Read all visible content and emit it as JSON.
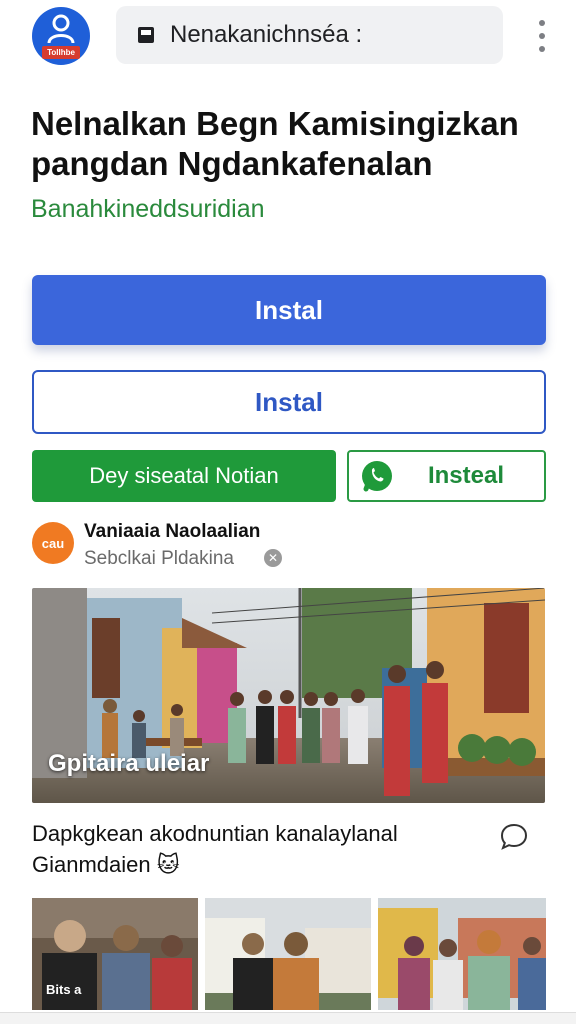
{
  "header": {
    "avatar_badge": "Tollhbe",
    "url": "Nenakanichnséa :",
    "menu_icon": "more-vert-icon"
  },
  "article": {
    "title": "Nelnalkan Begn Kamisingizkan pangdan Ngdankafenalan",
    "subtitle": "Banahkineddsuridian"
  },
  "buttons": {
    "primary_install": "Instal",
    "secondary_install": "Instal",
    "green_action": "Dey siseatal Notian",
    "whatsapp_action": "Insteal"
  },
  "source": {
    "logo_text": "cau",
    "name": "Vaniaaia Naolaalian",
    "subtitle": "Sebclkai Pldakina"
  },
  "hero": {
    "caption": "Gpitaira uleiar"
  },
  "story": {
    "title": "Dapkgkean akodnuntian kanalaylanal Gianmdaien 🐱"
  },
  "thumbnails": {
    "first_caption": "Bits a"
  },
  "colors": {
    "primary_blue": "#3b66db",
    "outline_blue": "#2f58c4",
    "green": "#1f9a3a",
    "subtitle_green": "#2a8a3c",
    "source_orange": "#f07a22"
  }
}
